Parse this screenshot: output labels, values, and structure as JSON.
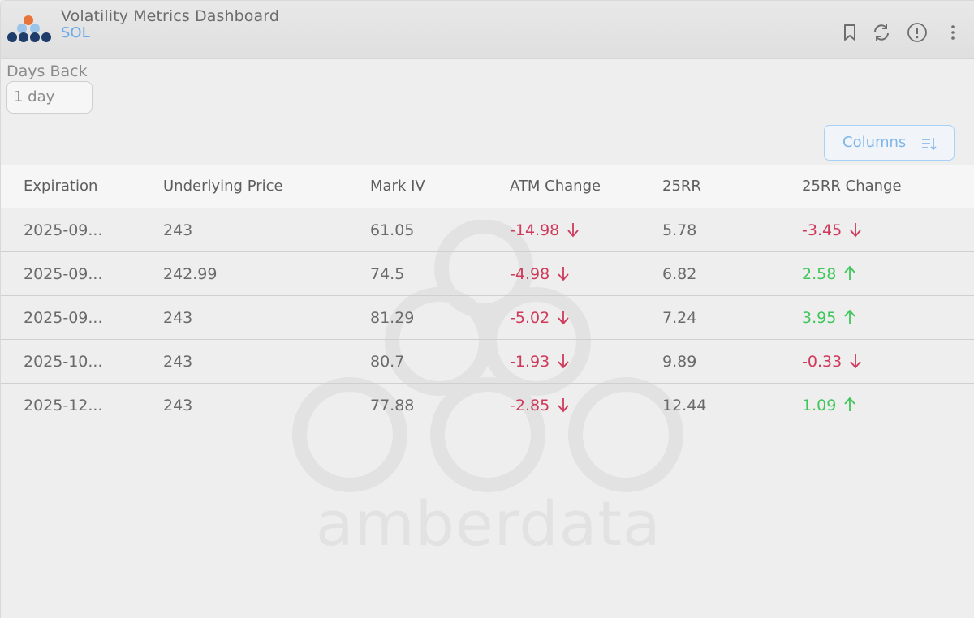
{
  "header": {
    "title": "Volatility Metrics Dashboard",
    "subtitle": "SOL",
    "icons": [
      "bookmark-icon",
      "refresh-icon",
      "info-icon",
      "more-vertical-icon"
    ]
  },
  "filters": {
    "days_back_label": "Days Back",
    "days_back_value": "1 day"
  },
  "toolbar": {
    "columns_label": "Columns"
  },
  "table": {
    "headers": [
      "Expiration",
      "Underlying Price",
      "Mark IV",
      "ATM Change",
      "25RR",
      "25RR Change"
    ],
    "rows": [
      {
        "expiration": "2025-09...",
        "underlying_price": "243",
        "mark_iv": "61.05",
        "atm_change": "-14.98",
        "atm_dir": "down",
        "rr25": "5.78",
        "rr25_change": "-3.45",
        "rr_dir": "down"
      },
      {
        "expiration": "2025-09...",
        "underlying_price": "242.99",
        "mark_iv": "74.5",
        "atm_change": "-4.98",
        "atm_dir": "down",
        "rr25": "6.82",
        "rr25_change": "2.58",
        "rr_dir": "up"
      },
      {
        "expiration": "2025-09...",
        "underlying_price": "243",
        "mark_iv": "81.29",
        "atm_change": "-5.02",
        "atm_dir": "down",
        "rr25": "7.24",
        "rr25_change": "3.95",
        "rr_dir": "up"
      },
      {
        "expiration": "2025-10...",
        "underlying_price": "243",
        "mark_iv": "80.7",
        "atm_change": "-1.93",
        "atm_dir": "down",
        "rr25": "9.89",
        "rr25_change": "-0.33",
        "rr_dir": "down"
      },
      {
        "expiration": "2025-12...",
        "underlying_price": "243",
        "mark_iv": "77.88",
        "atm_change": "-2.85",
        "atm_dir": "down",
        "rr25": "12.44",
        "rr25_change": "1.09",
        "rr_dir": "up"
      }
    ]
  },
  "watermark": {
    "text": "amberdata"
  },
  "colors": {
    "accent": "#6aa9ea",
    "negative": "#cf3a5b",
    "positive": "#3ec65a"
  }
}
